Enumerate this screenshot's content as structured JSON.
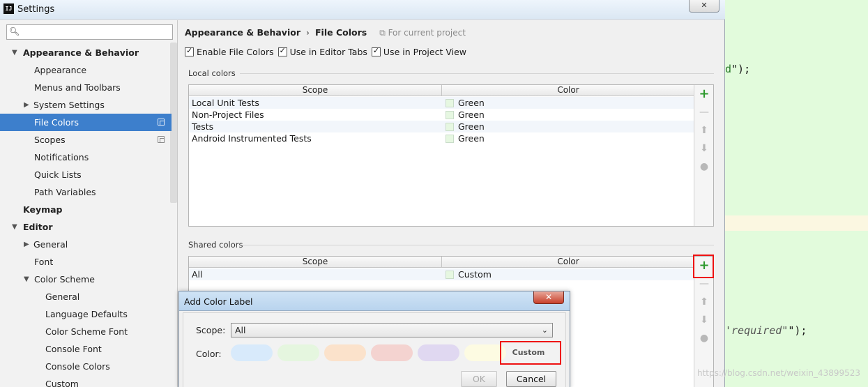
{
  "window": {
    "title": "Settings",
    "app_icon": "IJ",
    "close": "✕"
  },
  "search": {
    "placeholder": ""
  },
  "sidebar": {
    "items": [
      {
        "label": "Appearance & Behavior",
        "arrow": "▼"
      },
      {
        "label": "Appearance"
      },
      {
        "label": "Menus and Toolbars"
      },
      {
        "label": "System Settings",
        "arrow": "▶"
      },
      {
        "label": "File Colors"
      },
      {
        "label": "Scopes"
      },
      {
        "label": "Notifications"
      },
      {
        "label": "Quick Lists"
      },
      {
        "label": "Path Variables"
      },
      {
        "label": "Keymap"
      },
      {
        "label": "Editor",
        "arrow": "▼"
      },
      {
        "label": "General",
        "arrow": "▶"
      },
      {
        "label": "Font"
      },
      {
        "label": "Color Scheme",
        "arrow": "▼"
      },
      {
        "label": "General"
      },
      {
        "label": "Language Defaults"
      },
      {
        "label": "Color Scheme Font"
      },
      {
        "label": "Console Font"
      },
      {
        "label": "Console Colors"
      },
      {
        "label": "Custom"
      }
    ]
  },
  "breadcrumb": {
    "parent": "Appearance & Behavior",
    "sep": "›",
    "current": "File Colors",
    "hint": "For current project"
  },
  "options": {
    "enable": "Enable File Colors",
    "editor_tabs": "Use in Editor Tabs",
    "project_view": "Use in Project View"
  },
  "local": {
    "label": "Local colors",
    "headers": {
      "scope": "Scope",
      "color": "Color"
    },
    "rows": [
      {
        "scope": "Local Unit Tests",
        "color": "Green"
      },
      {
        "scope": "Non-Project Files",
        "color": "Green"
      },
      {
        "scope": "Tests",
        "color": "Green"
      },
      {
        "scope": "Android Instrumented Tests",
        "color": "Green"
      }
    ]
  },
  "shared": {
    "label": "Shared colors",
    "headers": {
      "scope": "Scope",
      "color": "Color"
    },
    "rows": [
      {
        "scope": "All",
        "color": "Custom"
      }
    ]
  },
  "toolbar": {
    "add": "+",
    "remove": "—",
    "up": "⬆",
    "down": "⬇",
    "eye": "●"
  },
  "dialog": {
    "title": "Add Color Label",
    "close": "✕",
    "scope_label": "Scope:",
    "scope_value": "All",
    "color_label": "Color:",
    "custom": "Custom",
    "ok": "OK",
    "cancel": "Cancel",
    "swatches": [
      "#d8eafb",
      "#e5f6df",
      "#fbe2cb",
      "#f4d3d0",
      "#e0d8f1",
      "#fdfbe2"
    ]
  },
  "editor": {
    "line1": "\");",
    "line2_str": "required",
    "line2_end": "\");"
  },
  "watermark": "https://blog.csdn.net/weixin_43899523"
}
